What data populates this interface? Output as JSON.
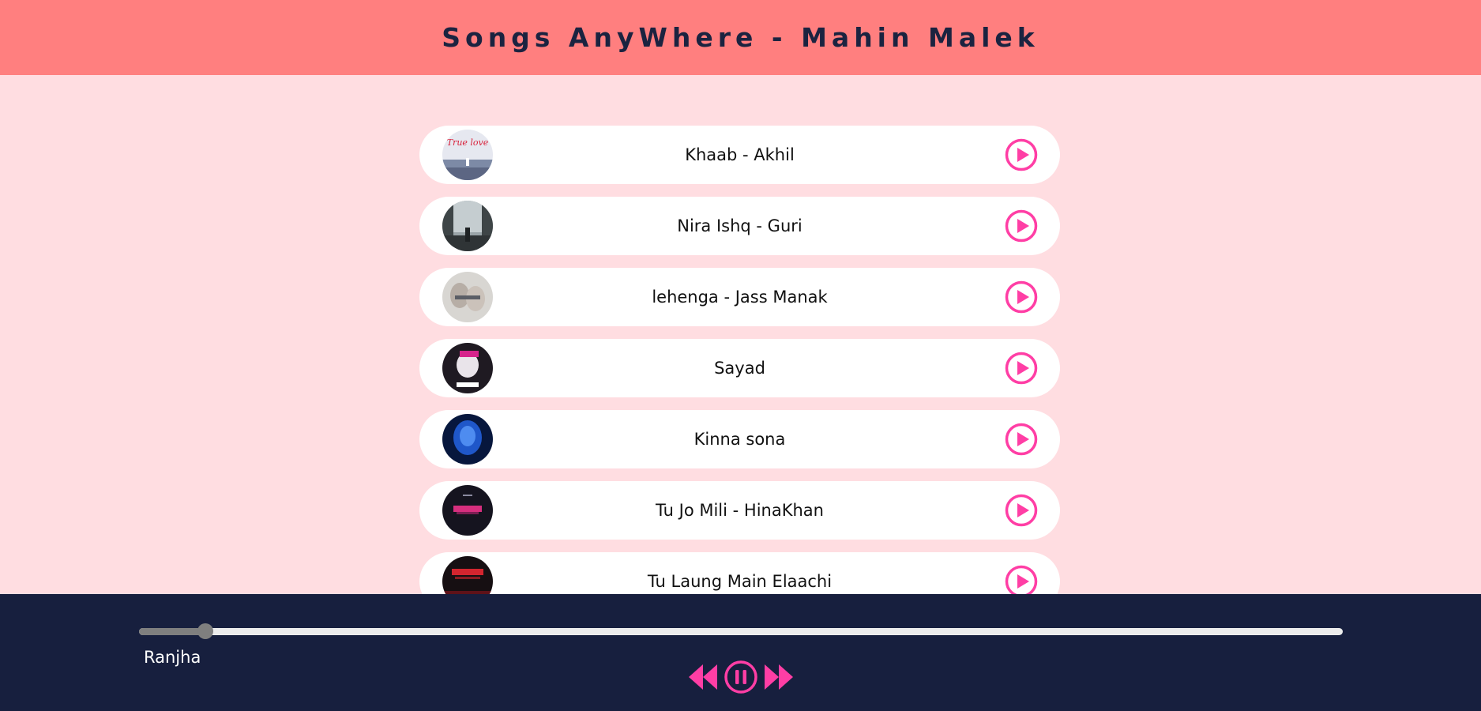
{
  "header": {
    "title": "Songs AnyWhere - Mahin Malek"
  },
  "songs": [
    {
      "title": "Khaab - Akhil",
      "cover_icon": "album-cover-true-love"
    },
    {
      "title": "Nira Ishq - Guri",
      "cover_icon": "album-cover-misty-figure"
    },
    {
      "title": "lehenga - Jass Manak",
      "cover_icon": "album-cover-couple"
    },
    {
      "title": "Sayad",
      "cover_icon": "album-cover-plug-walk"
    },
    {
      "title": "Kinna sona",
      "cover_icon": "album-cover-blue-face"
    },
    {
      "title": "Tu Jo Mili - HinaKhan",
      "cover_icon": "album-cover-neon-car"
    },
    {
      "title": "Tu Laung Main Elaachi",
      "cover_icon": "album-cover-they-mad"
    }
  ],
  "player": {
    "now_playing": "Ranjha",
    "progress_fraction": 0.055,
    "state": "playing"
  },
  "colors": {
    "header_bg": "#ff7f7f",
    "page_bg": "#ffdde1",
    "accent": "#ff3ea5",
    "player_bg": "#171f3e",
    "title_text": "#1b2340"
  }
}
